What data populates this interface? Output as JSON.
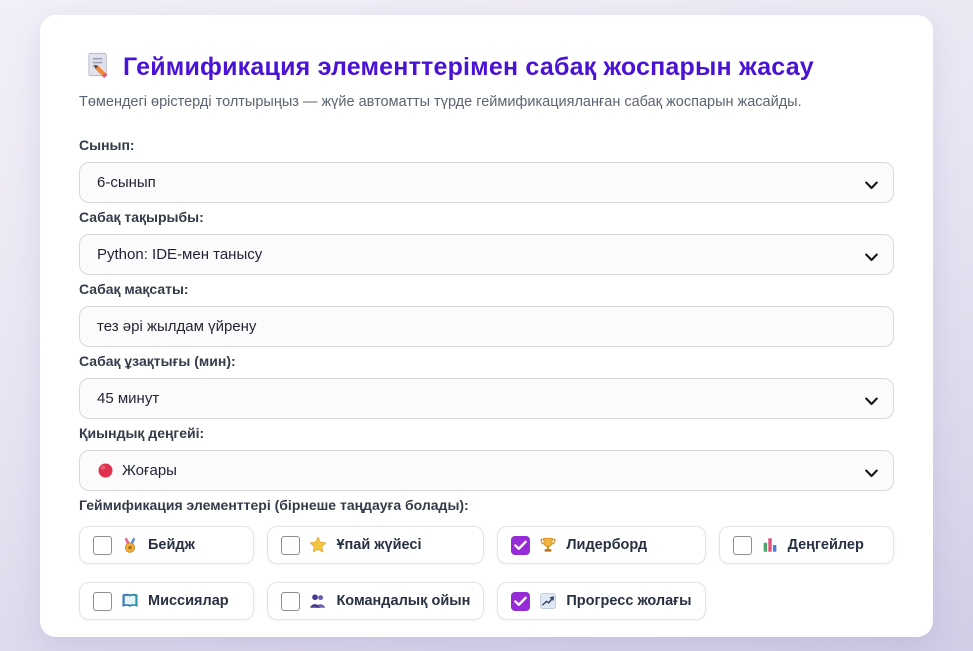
{
  "page": {
    "title": "Геймификация элементтерімен сабақ жоспарын жасау",
    "title_icon": "memo-icon",
    "subtitle": "Төмендегі өрістерді толтырыңыз — жүйе автоматты түрде геймификацияланған сабақ жоспарын жасайды."
  },
  "colors": {
    "title_accent": "#4a12d4",
    "checkbox_checked": "#962cd6",
    "page_background": "#e4e0f0",
    "difficulty_dot": "#e0354b"
  },
  "form": {
    "fields": [
      {
        "label": "Сынып:",
        "type": "select",
        "value": "6-сынып"
      },
      {
        "label": "Сабақ тақырыбы:",
        "type": "select",
        "value": "Python: IDE-мен танысу"
      },
      {
        "label": "Сабақ мақсаты:",
        "type": "text",
        "value": "тез әрі жылдам үйрену"
      },
      {
        "label": "Сабақ ұзақтығы (мин):",
        "type": "select",
        "value": "45 минут"
      },
      {
        "label": "Қиындық деңгейі:",
        "type": "select",
        "value": "Жоғары",
        "value_icon": "red-circle-icon"
      }
    ],
    "elements_label": "Геймификация элементтері (бірнеше таңдауға болады):",
    "elements": [
      {
        "label": "Бейдж",
        "icon": "medal-icon",
        "checked": false
      },
      {
        "label": "Ұпай жүйесі",
        "icon": "star-icon",
        "checked": false
      },
      {
        "label": "Лидерборд",
        "icon": "trophy-icon",
        "checked": true
      },
      {
        "label": "Деңгейлер",
        "icon": "bar-chart-icon",
        "checked": false
      },
      {
        "label": "Миссиялар",
        "icon": "open-book-icon",
        "checked": false
      },
      {
        "label": "Командалық ойын",
        "icon": "team-icon",
        "checked": false
      },
      {
        "label": "Прогресс жолағы",
        "icon": "progress-chart-icon",
        "checked": true
      }
    ]
  }
}
